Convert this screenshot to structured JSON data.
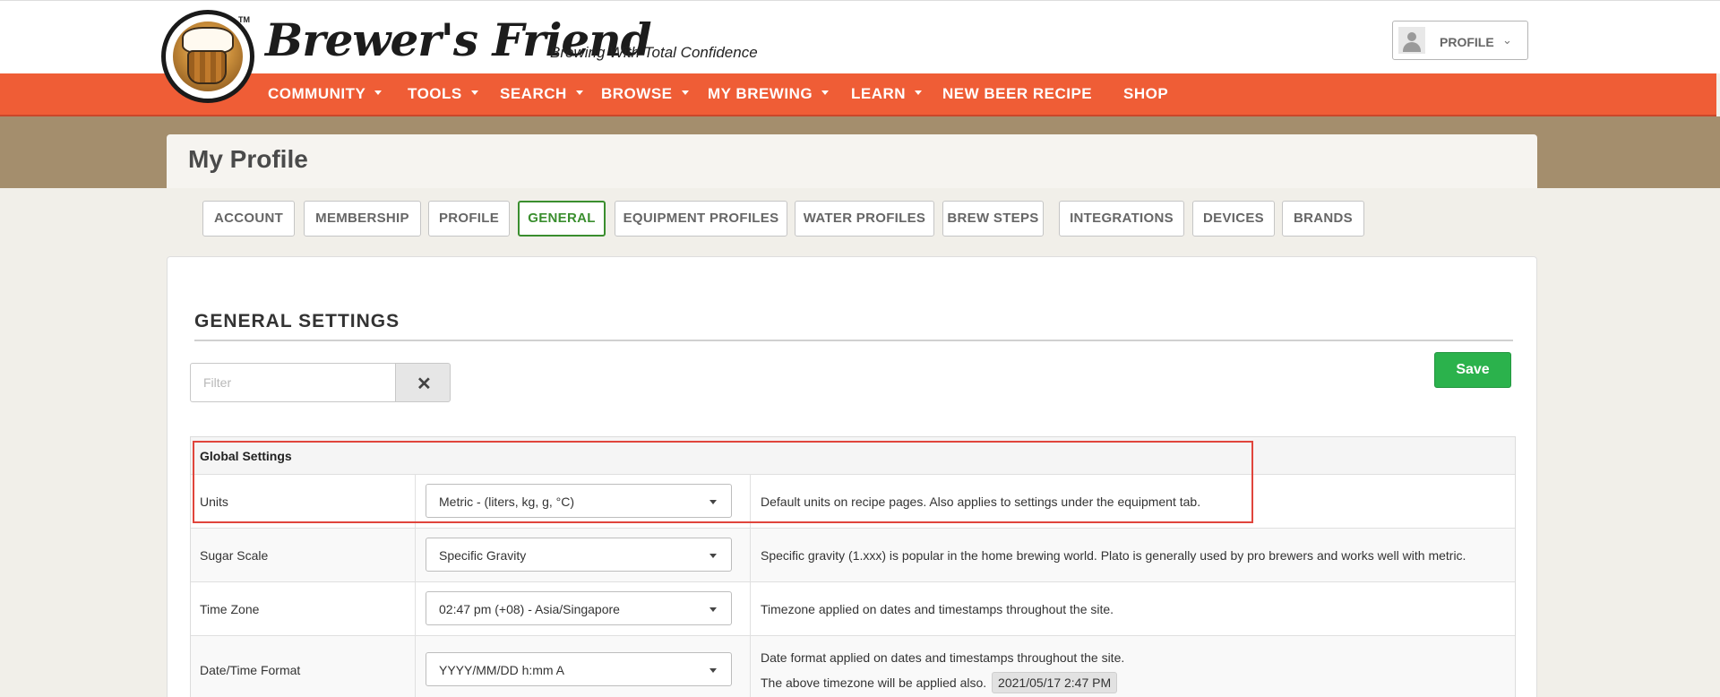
{
  "header": {
    "brand": "Brewer's Friend",
    "tagline": "Brewing With Total Confidence",
    "trademark": "TM",
    "profile_label": "PROFILE",
    "profile_chevron": "⌄"
  },
  "nav": {
    "items": [
      {
        "label": "COMMUNITY",
        "dropdown": true
      },
      {
        "label": "TOOLS",
        "dropdown": true
      },
      {
        "label": "SEARCH",
        "dropdown": true
      },
      {
        "label": "BROWSE",
        "dropdown": true
      },
      {
        "label": "MY BREWING",
        "dropdown": true
      },
      {
        "label": "LEARN",
        "dropdown": true
      },
      {
        "label": "NEW BEER RECIPE",
        "dropdown": false
      },
      {
        "label": "SHOP",
        "dropdown": false
      }
    ]
  },
  "page": {
    "title": "My Profile"
  },
  "tabs": {
    "items": [
      "ACCOUNT",
      "MEMBERSHIP",
      "PROFILE",
      "GENERAL",
      "EQUIPMENT PROFILES",
      "WATER PROFILES",
      "BREW STEPS",
      "INTEGRATIONS",
      "DEVICES",
      "BRANDS"
    ],
    "active": "GENERAL"
  },
  "settings": {
    "section_title": "GENERAL SETTINGS",
    "filter_placeholder": "Filter",
    "filter_value": "",
    "clear_icon": "✕",
    "save_label": "Save",
    "group_label": "Global Settings",
    "rows": [
      {
        "name": "Units",
        "value": "Metric - (liters, kg, g, °C)",
        "description": "Default units on recipe pages. Also applies to settings under the equipment tab."
      },
      {
        "name": "Sugar Scale",
        "value": "Specific Gravity",
        "description": "Specific gravity (1.xxx) is popular in the home brewing world. Plato is generally used by pro brewers and works well with metric."
      },
      {
        "name": "Time Zone",
        "value": "02:47 pm (+08) - Asia/Singapore",
        "description": "Timezone applied on dates and timestamps throughout the site."
      },
      {
        "name": "Date/Time Format",
        "value": "YYYY/MM/DD h:mm A",
        "description": "Date format applied on dates and timestamps throughout the site.",
        "description_line2": "The above timezone will be applied also.",
        "sample": "2021/05/17 2:47 PM"
      }
    ]
  },
  "colors": {
    "nav_bg": "#ef5d36",
    "band": "#a48e6d",
    "active_tab": "#3a8e2e",
    "save": "#2bb24c",
    "highlight": "#e0453c"
  },
  "icons": {
    "logo": "beer-mug-logo-icon",
    "avatar": "user-avatar-icon",
    "caret": "caret-down-icon",
    "clear": "close-icon",
    "select_arrow": "chevron-down-icon"
  }
}
